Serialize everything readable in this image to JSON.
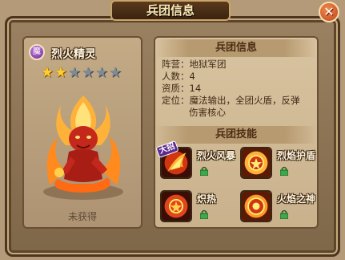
{
  "dialog": {
    "title": "兵团信息",
    "close_glyph": "✕"
  },
  "hero": {
    "faction_badge": "魔",
    "name": "烈火精灵",
    "stars_filled": 2,
    "stars_total": 6,
    "status": "未获得"
  },
  "info": {
    "section_title": "兵团信息",
    "lines": [
      "阵营：地狱军团",
      "人数：4",
      "资质：14",
      "定位：魔法输出，全团火盾，反弹",
      "伤害核心"
    ]
  },
  "skills": {
    "section_title": "兵团技能",
    "items": [
      {
        "name": "烈火风暴",
        "icon": "fire-storm-icon",
        "tag": "大招"
      },
      {
        "name": "烈焰护盾",
        "icon": "flame-shield-icon",
        "tag": ""
      },
      {
        "name": "炽热",
        "icon": "blazing-icon",
        "tag": ""
      },
      {
        "name": "火焰之神",
        "icon": "fire-god-icon",
        "tag": ""
      }
    ]
  },
  "colors": {
    "star_on": "#ffcf2d",
    "star_off": "#7f8b97",
    "lock": "#3fa84a"
  }
}
